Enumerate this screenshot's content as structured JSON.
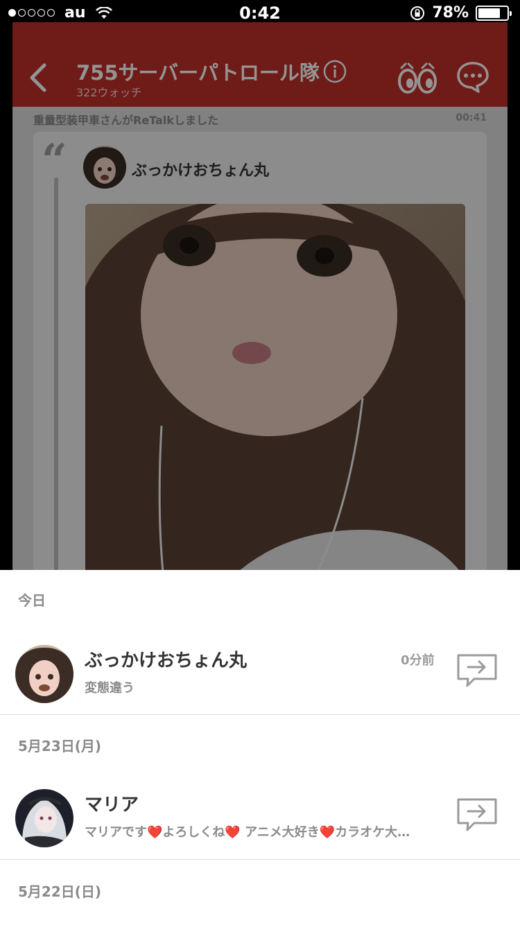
{
  "status_bar": {
    "carrier": "au",
    "time": "0:42",
    "battery_percent": "78%",
    "battery_level": 0.78,
    "signal_bars": 1
  },
  "app": {
    "title": "755サーバーパトロール隊",
    "watch_count": "322ウォッチ",
    "accent_color": "#c0312a",
    "retalk_notice": "重量型装甲車さんがReTalkしました",
    "retalk_time": "00:41",
    "post_author": "ぶっかけおちょん丸"
  },
  "sheet": {
    "sections": [
      {
        "header": "今日",
        "items": [
          {
            "name": "ぶっかけおちょん丸",
            "message": "変態違う",
            "time_ago": "0分前"
          }
        ]
      },
      {
        "header": "5月23日(月)",
        "items": [
          {
            "name": "マリア",
            "message": "マリアです❤️よろしくね❤️ アニメ大好き❤️カラオケ大…"
          }
        ]
      },
      {
        "header": "5月22日(日)",
        "items": []
      }
    ]
  },
  "icons": {
    "back": "chevron-left-icon",
    "info": "info-icon",
    "watch": "eyes-icon",
    "chat": "chat-bubble-icon",
    "share": "share-arrow-icon"
  }
}
